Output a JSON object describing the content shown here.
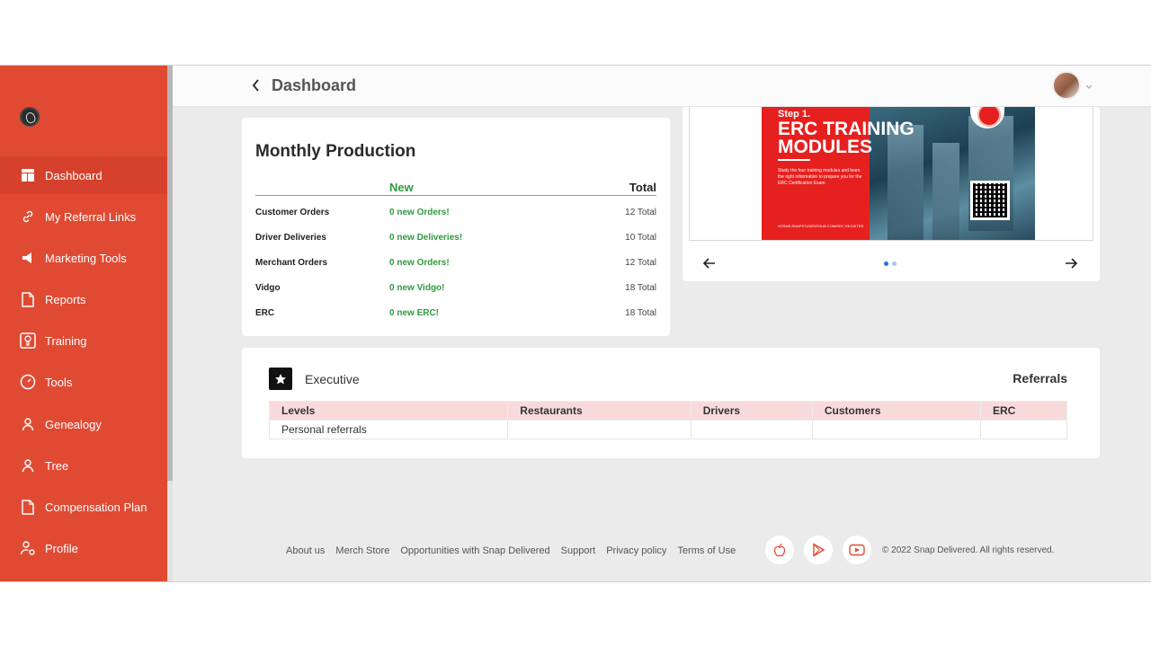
{
  "sidebar": {
    "items": [
      {
        "label": "Dashboard",
        "icon": "dashboard-icon",
        "active": true
      },
      {
        "label": "My Referral Links",
        "icon": "link-icon"
      },
      {
        "label": "Marketing Tools",
        "icon": "megaphone-icon"
      },
      {
        "label": "Reports",
        "icon": "document-icon"
      },
      {
        "label": "Training",
        "icon": "training-icon"
      },
      {
        "label": "Tools",
        "icon": "gauge-icon"
      },
      {
        "label": "Genealogy",
        "icon": "person-icon"
      },
      {
        "label": "Tree",
        "icon": "person-icon"
      },
      {
        "label": "Compensation Plan",
        "icon": "document-icon"
      },
      {
        "label": "Profile",
        "icon": "profile-gear-icon"
      }
    ]
  },
  "header": {
    "title": "Dashboard"
  },
  "monthly_production": {
    "title": "Monthly Production",
    "col_new": "New",
    "col_total": "Total",
    "rows": [
      {
        "name": "Customer Orders",
        "new": "0 new Orders!",
        "total": "12 Total"
      },
      {
        "name": "Driver Deliveries",
        "new": "0 new Deliveries!",
        "total": "10 Total"
      },
      {
        "name": "Merchant Orders",
        "new": "0 new Orders!",
        "total": "12 Total"
      },
      {
        "name": "Vidgo",
        "new": "0 new Vidgo!",
        "total": "18 Total"
      },
      {
        "name": "ERC",
        "new": "0 new ERC!",
        "total": "18 Total"
      }
    ]
  },
  "carousel": {
    "step": "Step 1.",
    "title": "ERC TRAINING MODULES",
    "body": "Study the four training modules and learn the right information to prepare you for the ERC Certification Exam",
    "url": "SCRMS.SNAPSTUDENTHUB.COM/ERC REGISTER",
    "slide_count": 2,
    "active_slide": 1
  },
  "executive": {
    "title": "Executive",
    "referrals_label": "Referrals",
    "columns": [
      "Levels",
      "Restaurants",
      "Drivers",
      "Customers",
      "ERC"
    ],
    "rows": [
      [
        "Personal referrals",
        "",
        "",
        "",
        ""
      ]
    ]
  },
  "footer": {
    "links": [
      "About us",
      "Merch Store",
      "Opportunities with Snap Delivered",
      "Support",
      "Privacy policy",
      "Terms of Use"
    ],
    "social": [
      "apple-icon",
      "play-store-icon",
      "youtube-icon"
    ],
    "copyright": "© 2022 Snap Delivered. All rights reserved."
  },
  "colors": {
    "sidebar": "#e04a33",
    "active": "#d5412c",
    "green": "#2f9a3f",
    "table_header": "#f9dada"
  }
}
